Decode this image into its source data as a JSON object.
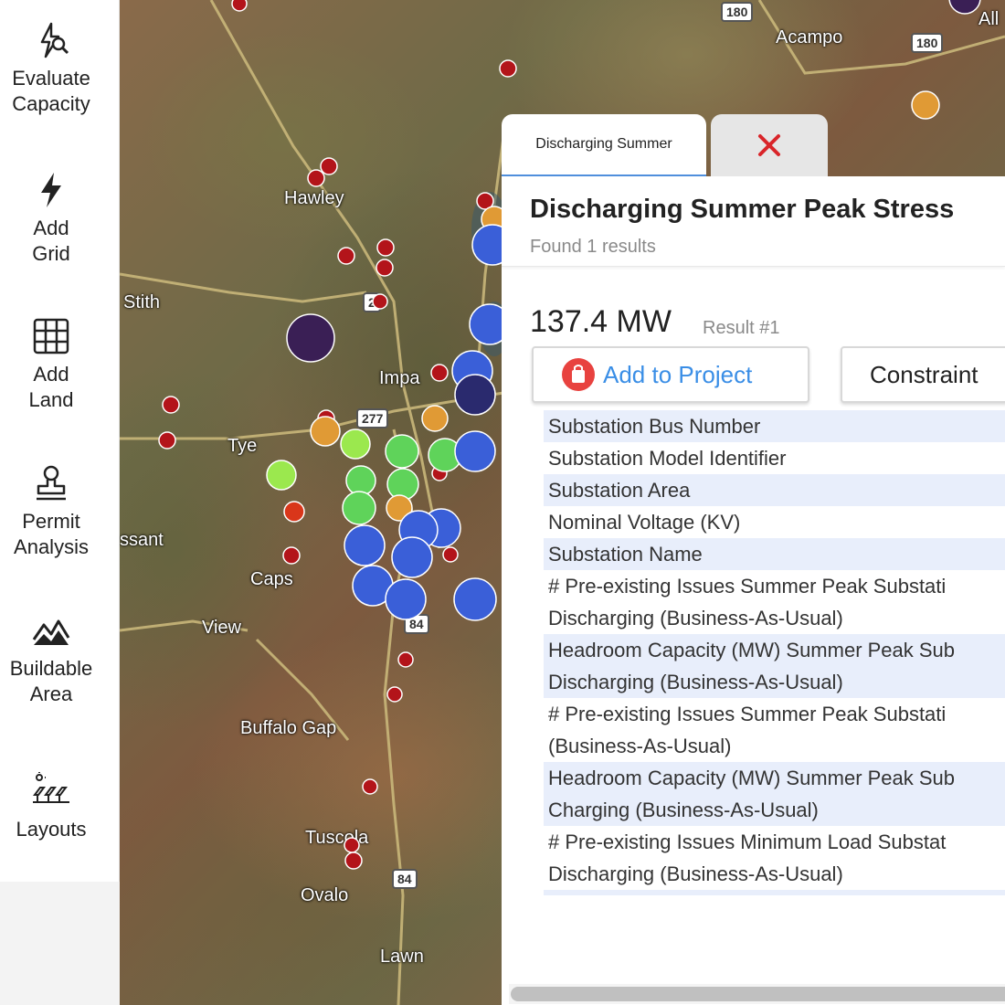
{
  "sidebar": {
    "tools": [
      {
        "label": "Evaluate\nCapacity",
        "icon": "lightning-search-icon"
      },
      {
        "label": "Add\nGrid",
        "icon": "lightning-icon"
      },
      {
        "label": "Add\nLand",
        "icon": "grid-icon"
      },
      {
        "label": "Permit\nAnalysis",
        "icon": "stamp-icon"
      },
      {
        "label": "Buildable\nArea",
        "icon": "terrain-icon"
      },
      {
        "label": "Layouts",
        "icon": "solar-layout-icon"
      }
    ]
  },
  "map": {
    "places": [
      "Acampo",
      "Hawley",
      "Stith",
      "Impa",
      "Tye",
      "ssant",
      "Caps",
      "View",
      "Buffalo Gap",
      "Tuscola",
      "Ovalo",
      "Lawn",
      "All"
    ],
    "shields": [
      "180",
      "180",
      "277",
      "84",
      "84",
      "2"
    ],
    "marker_colors": {
      "substation_small": "#b3141a",
      "high": "#3a5fd8",
      "very_high": "#2a2a6e",
      "highest": "#3a1f55",
      "medium": "#e09a35",
      "low": "#5fd35a",
      "lowest": "#9be84e",
      "red_large": "#d9361a"
    }
  },
  "panel": {
    "tab_label": "Discharging Summer",
    "close_icon": "close-x-icon",
    "title": "Discharging Summer Peak Stress",
    "subtitle": "Found 1 results",
    "value": "137.4 MW",
    "result_label": "Result #1",
    "add_button": "Add to Project",
    "constraint_button": "Constraint",
    "attributes": [
      "Substation Bus Number",
      "Substation Model Identifier",
      "Substation Area",
      "Nominal Voltage (KV)",
      "Substation Name",
      "# Pre-existing Issues Summer Peak Substati",
      "Discharging (Business-As-Usual)",
      "Headroom Capacity (MW) Summer Peak Sub",
      "Discharging (Business-As-Usual)",
      "# Pre-existing Issues Summer Peak Substati",
      "(Business-As-Usual)",
      "Headroom Capacity (MW) Summer Peak Sub",
      "Charging (Business-As-Usual)",
      "# Pre-existing Issues Minimum Load Substat",
      "Discharging (Business-As-Usual)"
    ],
    "accent_color": "#3a8ee6",
    "close_color": "#d9252a"
  }
}
